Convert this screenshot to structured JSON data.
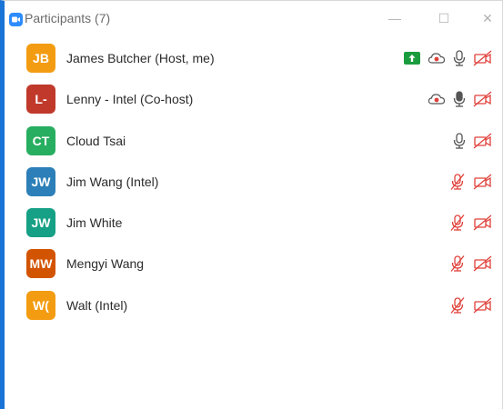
{
  "window": {
    "title": "Participants (7)",
    "accent": "#1a73d6",
    "minimize_glyph": "—",
    "maximize_glyph": "☐",
    "close_glyph": "✕"
  },
  "participants": [
    {
      "initials": "JB",
      "name": "James Butcher (Host, me)",
      "avatar_color": "#f39c12",
      "share": true,
      "record": true,
      "mic": "on",
      "video": "off"
    },
    {
      "initials": "L-",
      "name": "Lenny - Intel (Co-host)",
      "avatar_color": "#c0392b",
      "share": false,
      "record": true,
      "mic": "active",
      "video": "off"
    },
    {
      "initials": "CT",
      "name": "Cloud Tsai",
      "avatar_color": "#27ae60",
      "share": false,
      "record": false,
      "mic": "on",
      "video": "off"
    },
    {
      "initials": "JW",
      "name": "Jim Wang (Intel)",
      "avatar_color": "#2c7fb8",
      "share": false,
      "record": false,
      "mic": "muted",
      "video": "off"
    },
    {
      "initials": "JW",
      "name": "Jim White",
      "avatar_color": "#16a085",
      "share": false,
      "record": false,
      "mic": "muted",
      "video": "off"
    },
    {
      "initials": "MW",
      "name": "Mengyi Wang",
      "avatar_color": "#d35400",
      "share": false,
      "record": false,
      "mic": "muted",
      "video": "off"
    },
    {
      "initials": "W(",
      "name": "Walt (Intel)",
      "avatar_color": "#f39c12",
      "share": false,
      "record": false,
      "mic": "muted",
      "video": "off"
    }
  ],
  "colors": {
    "share_green": "#1a9c3e",
    "muted_red": "#e0403a",
    "mic_gray": "#555555"
  }
}
